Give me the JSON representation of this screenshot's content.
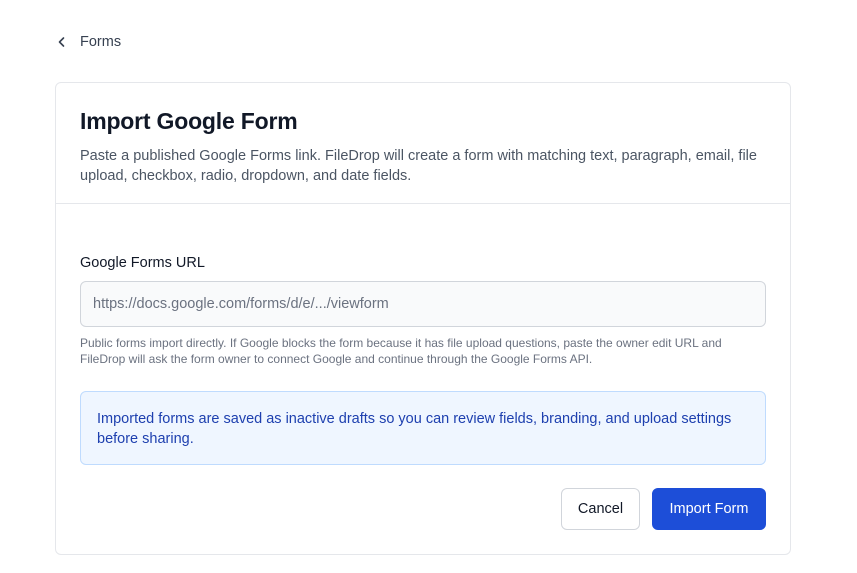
{
  "nav": {
    "back_label": "Forms",
    "back_icon": "chevron-left-icon"
  },
  "card": {
    "title": "Import Google Form",
    "description": "Paste a published Google Forms link. FileDrop will create a form with matching text, paragraph, email, file upload, checkbox, radio, dropdown, and date fields."
  },
  "form": {
    "url_label": "Google Forms URL",
    "url_value": "",
    "url_placeholder": "https://docs.google.com/forms/d/e/.../viewform",
    "help_text": "Public forms import directly. If Google blocks the form because it has file upload questions, paste the owner edit URL and FileDrop will ask the form owner to connect Google and continue through the Google Forms API."
  },
  "info": {
    "text": "Imported forms are saved as inactive drafts so you can review fields, branding, and upload settings before sharing."
  },
  "actions": {
    "cancel_label": "Cancel",
    "submit_label": "Import Form"
  },
  "colors": {
    "primary": "#1d4ed8",
    "info_bg": "#eff6ff",
    "info_text": "#1e40af"
  }
}
